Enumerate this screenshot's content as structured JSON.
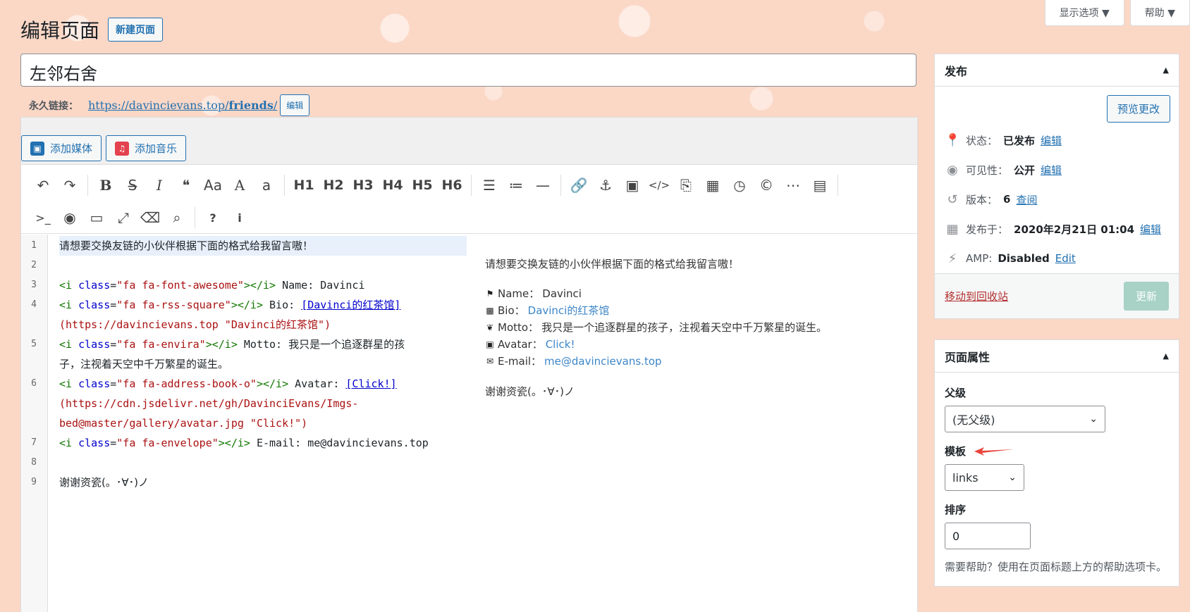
{
  "header": {
    "title": "编辑页面",
    "new_page": "新建页面",
    "screen_options": "显示选项 ▼",
    "help": "帮助 ▼"
  },
  "post": {
    "title": "左邻右舍",
    "permalink_label": "永久链接：",
    "permalink_base": "https://davincievans.top/",
    "permalink_slug": "friends",
    "permalink_tail": "/",
    "permalink_edit": "编辑"
  },
  "media": {
    "add_media": "添加媒体",
    "add_music": "添加音乐"
  },
  "toolbar": {
    "row1": [
      "↶",
      "↷",
      "B",
      "S̶",
      "I",
      "❝",
      "Aa",
      "A",
      "a",
      "H1",
      "H2",
      "H3",
      "H4",
      "H5",
      "H6",
      "☰",
      "≔",
      "—",
      "🔗",
      "⚓",
      "▣",
      "</>",
      "⎘",
      "▦",
      "◷",
      "©",
      "⋯",
      "▤"
    ],
    "row2": [
      ">_",
      "◉",
      "▭",
      "⤢",
      "⌫",
      "⌕",
      "?",
      "i"
    ]
  },
  "code": {
    "lines": [
      {
        "n": "1",
        "text": "请想要交换友链的小伙伴根据下面的格式给我留言嗷！"
      },
      {
        "n": "2",
        "text": ""
      },
      {
        "n": "3",
        "text": "<i class=\"fa fa-font-awesome\"></i> Name: Davinci"
      },
      {
        "n": "4",
        "text": "<i class=\"fa fa-rss-square\"></i> Bio: [Davinci的红茶馆]"
      },
      {
        "n": "",
        "text": "(https://davincievans.top \"Davinci的红茶馆\")"
      },
      {
        "n": "5",
        "text": "<i class=\"fa fa-envira\"></i> Motto: 我只是一个追逐群星的孩"
      },
      {
        "n": "",
        "text": "子，注视着天空中千万繁星的诞生。"
      },
      {
        "n": "6",
        "text": "<i class=\"fa fa-address-book-o\"></i> Avatar: [Click!]"
      },
      {
        "n": "",
        "text": "(https://cdn.jsdelivr.net/gh/DavinciEvans/Imgs-"
      },
      {
        "n": "",
        "text": "bed@master/gallery/avatar.jpg \"Click!\")"
      },
      {
        "n": "7",
        "text": "<i class=\"fa fa-envelope\"></i> E-mail: me@davincievans.top"
      },
      {
        "n": "8",
        "text": ""
      },
      {
        "n": "9",
        "text": "谢谢资瓷(。･∀･)ノ"
      }
    ]
  },
  "preview": {
    "intro": "请想要交换友链的小伙伴根据下面的格式给我留言嗷！",
    "items": [
      {
        "icon": "⚑",
        "label": "Name：",
        "value": "Davinci",
        "link": false
      },
      {
        "icon": "▩",
        "label": "Bio：",
        "value": "Davinci的红茶馆",
        "link": true
      },
      {
        "icon": "❦",
        "label": "Motto：",
        "value": "我只是一个追逐群星的孩子，注视着天空中千万繁星的诞生。",
        "link": false
      },
      {
        "icon": "▣",
        "label": "Avatar：",
        "value": "Click!",
        "link": true
      },
      {
        "icon": "✉",
        "label": "E-mail：",
        "value": "me@davincievans.top",
        "link": true
      }
    ],
    "thanks": "谢谢资瓷(。･∀･)ノ"
  },
  "publish": {
    "title": "发布",
    "preview_btn": "预览更改",
    "status_label": "状态：",
    "status_value": "已发布",
    "visibility_label": "可见性：",
    "visibility_value": "公开",
    "revisions_label": "版本：",
    "revisions_value": "6",
    "revisions_link": "查阅",
    "published_label": "发布于：",
    "published_value": "2020年2月21日 01:04",
    "amp_label": "AMP:",
    "amp_value": "Disabled",
    "amp_link": "Edit",
    "edit_link": "编辑",
    "trash": "移动到回收站",
    "update": "更新"
  },
  "attributes": {
    "title": "页面属性",
    "parent_label": "父级",
    "parent_value": "(无父级)",
    "template_label": "模板",
    "template_value": "links",
    "order_label": "排序",
    "order_value": "0",
    "help": "需要帮助？使用在页面标题上方的帮助选项卡。"
  },
  "colors": {
    "accent": "#2271b1",
    "background": "#fbd7c6",
    "update_disabled": "#a7d2c5",
    "trash": "#b32d2e",
    "arrow": "#e8453c"
  }
}
